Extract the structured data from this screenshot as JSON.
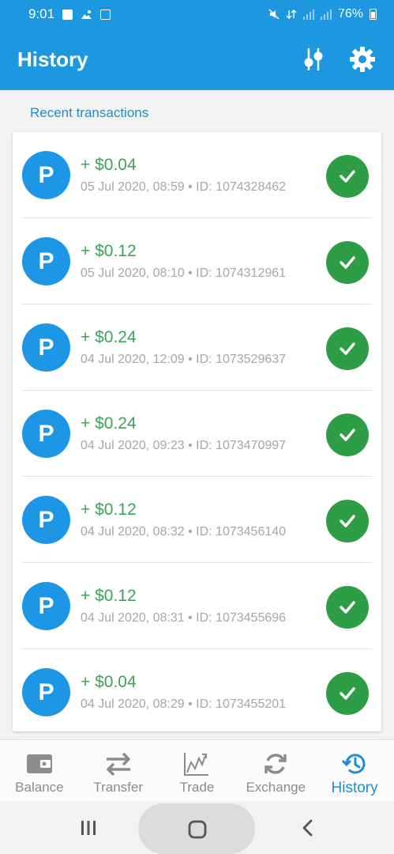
{
  "status_bar": {
    "time": "9:01",
    "battery": "76%"
  },
  "app_bar": {
    "title": "History",
    "filter_icon": "sliders-icon",
    "settings_icon": "gear-icon"
  },
  "section_label": "Recent transactions",
  "transactions": [
    {
      "avatar": "P",
      "amount": "+ $0.04",
      "meta": "05 Jul 2020, 08:59 • ID: 1074328462",
      "status": "completed"
    },
    {
      "avatar": "P",
      "amount": "+ $0.12",
      "meta": "05 Jul 2020, 08:10 • ID: 1074312961",
      "status": "completed"
    },
    {
      "avatar": "P",
      "amount": "+ $0.24",
      "meta": "04 Jul 2020, 12:09 • ID: 1073529637",
      "status": "completed"
    },
    {
      "avatar": "P",
      "amount": "+ $0.24",
      "meta": "04 Jul 2020, 09:23 • ID: 1073470997",
      "status": "completed"
    },
    {
      "avatar": "P",
      "amount": "+ $0.12",
      "meta": "04 Jul 2020, 08:32 • ID: 1073456140",
      "status": "completed"
    },
    {
      "avatar": "P",
      "amount": "+ $0.12",
      "meta": "04 Jul 2020, 08:31 • ID: 1073455696",
      "status": "completed"
    },
    {
      "avatar": "P",
      "amount": "+ $0.04",
      "meta": "04 Jul 2020, 08:29 • ID: 1073455201",
      "status": "completed"
    }
  ],
  "bottom_nav": {
    "items": [
      {
        "label": "Balance",
        "icon": "wallet-icon"
      },
      {
        "label": "Transfer",
        "icon": "transfer-arrows-icon"
      },
      {
        "label": "Trade",
        "icon": "chart-icon"
      },
      {
        "label": "Exchange",
        "icon": "refresh-icon"
      },
      {
        "label": "History",
        "icon": "history-icon",
        "active": true
      }
    ]
  },
  "colors": {
    "primary": "#1c97e0",
    "accent_text": "#1c8ed6",
    "amount_green": "#3aa55a",
    "check_green": "#2e9e46",
    "avatar_blue": "#1e96e6"
  }
}
